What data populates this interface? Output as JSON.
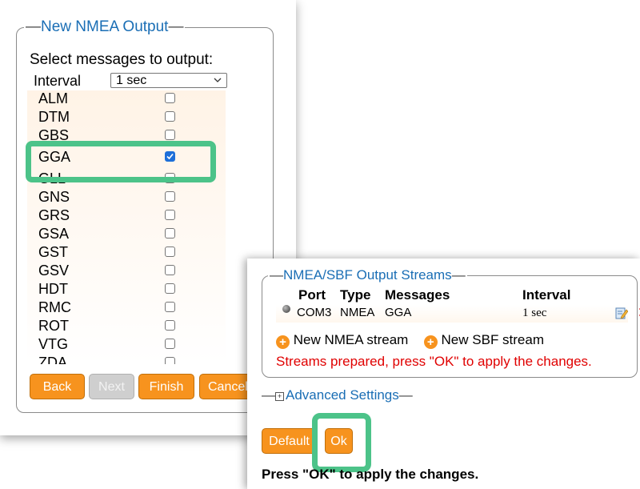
{
  "new_output": {
    "legend": "New NMEA Output",
    "prompt": "Select messages to output:",
    "interval_label": "Interval",
    "interval_value": "1 sec",
    "messages": [
      {
        "name": "ALM",
        "checked": false
      },
      {
        "name": "DTM",
        "checked": false
      },
      {
        "name": "GBS",
        "checked": false
      },
      {
        "name": "GGA",
        "checked": true
      },
      {
        "name": "GLL",
        "checked": false
      },
      {
        "name": "GNS",
        "checked": false
      },
      {
        "name": "GRS",
        "checked": false
      },
      {
        "name": "GSA",
        "checked": false
      },
      {
        "name": "GST",
        "checked": false
      },
      {
        "name": "GSV",
        "checked": false
      },
      {
        "name": "HDT",
        "checked": false
      },
      {
        "name": "RMC",
        "checked": false
      },
      {
        "name": "ROT",
        "checked": false
      },
      {
        "name": "VTG",
        "checked": false
      },
      {
        "name": "ZDA",
        "checked": false
      }
    ],
    "buttons": {
      "back": "Back",
      "next": "Next",
      "finish": "Finish",
      "cancel": "Cancel"
    }
  },
  "streams": {
    "legend": "NMEA/SBF Output Streams",
    "headers": {
      "port": "Port",
      "type": "Type",
      "messages": "Messages",
      "interval": "Interval"
    },
    "rows": [
      {
        "port": "COM3",
        "type": "NMEA",
        "messages": "GGA",
        "interval": "1 sec"
      }
    ],
    "new_nmea": "New NMEA stream",
    "new_sbf": "New SBF stream",
    "warning": "Streams prepared, press \"OK\" to apply the changes."
  },
  "advanced_settings": "Advanced Settings",
  "buttons": {
    "default": "Default",
    "ok": "Ok"
  },
  "apply_prompt": "Press \"OK\" to apply the changes.",
  "colors": {
    "accent_orange": "#f7931e",
    "highlight_green": "#4cc389",
    "link_blue": "#1a6eb5",
    "warning_red": "#e00000"
  }
}
